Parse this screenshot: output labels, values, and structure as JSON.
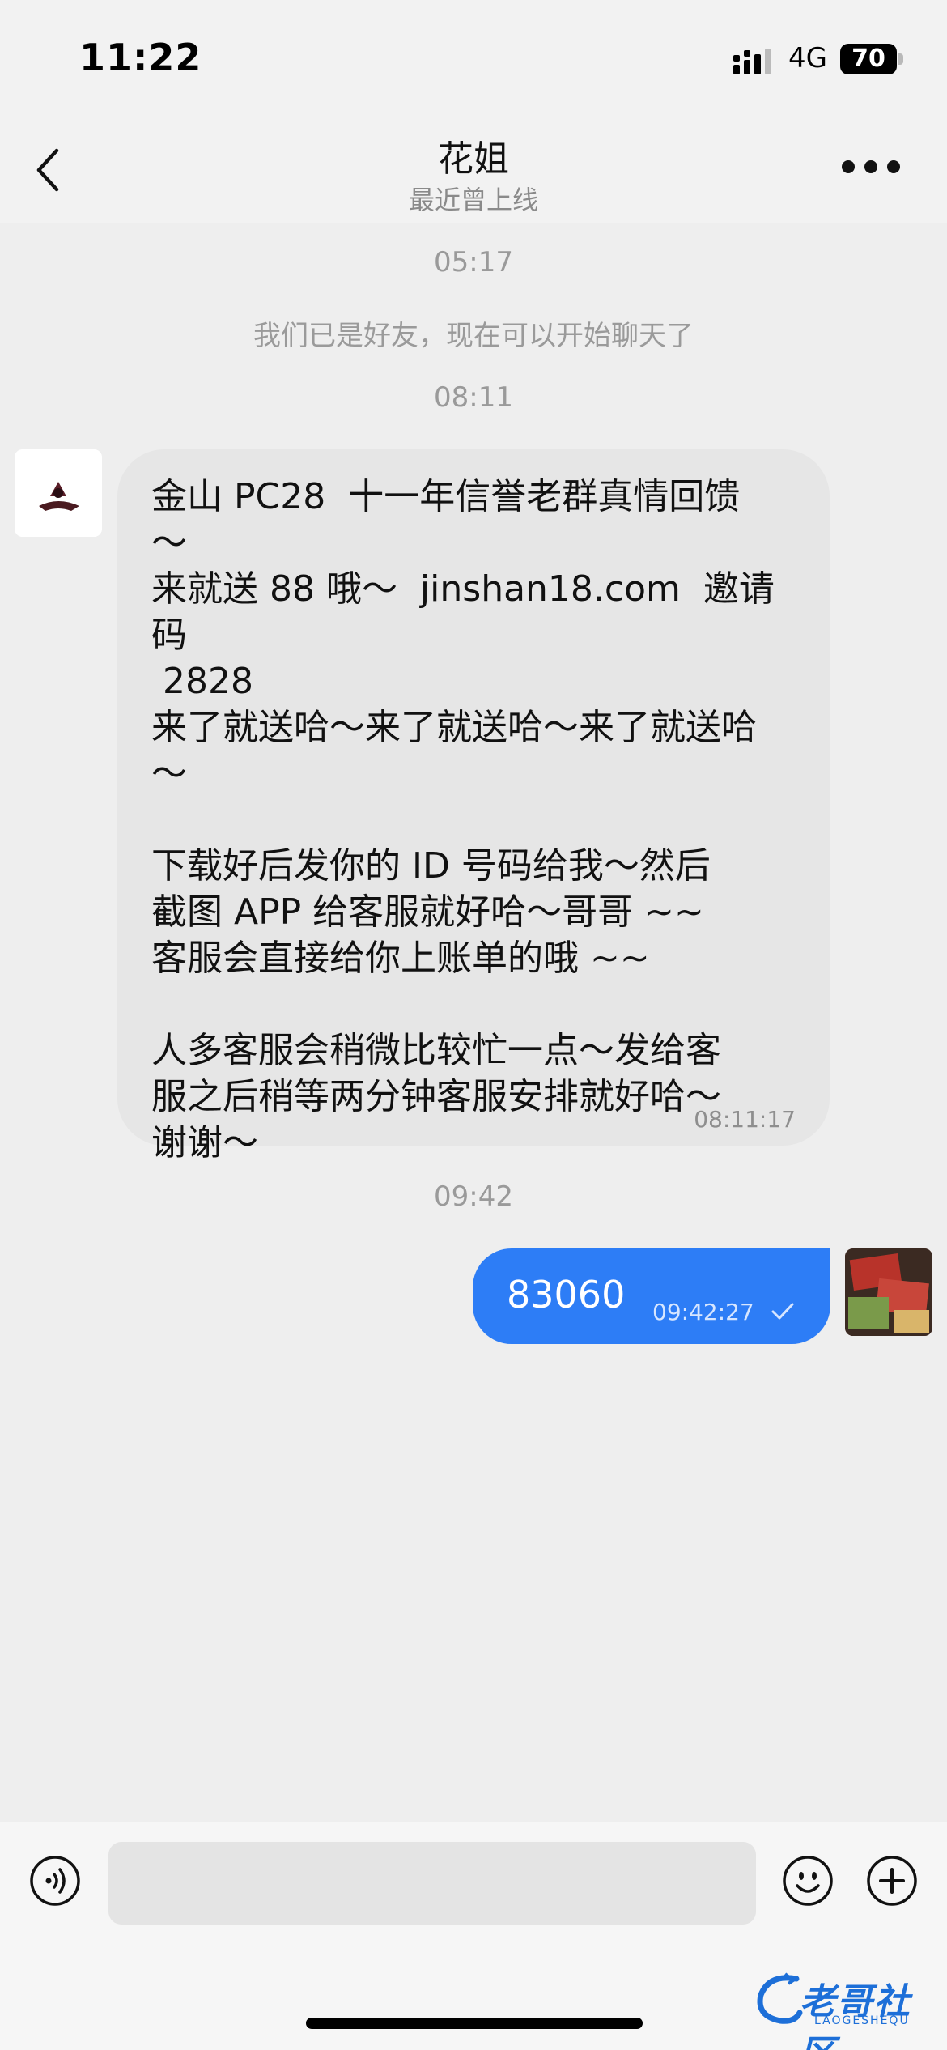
{
  "status_bar": {
    "time": "11:22",
    "network": "4G",
    "battery": "70"
  },
  "header": {
    "name": "花姐",
    "status": "最近曾上线"
  },
  "chat": {
    "separators": [
      "05:17",
      "08:11",
      "09:42"
    ],
    "system_message": "我们已是好友，现在可以开始聊天了",
    "incoming": {
      "lines": [
        "金山 PC28  十一年信誉老群真情回馈",
        "～",
        "来就送 88 哦～  jinshan18.com  邀请码",
        " 2828",
        "来了就送哈～来了就送哈～来了就送哈",
        "～",
        "",
        "下载好后发你的 ID 号码给我～然后",
        "截图 APP 给客服就好哈～哥哥 ~~",
        "客服会直接给你上账单的哦 ~~",
        "",
        "人多客服会稍微比较忙一点～发给客",
        "服之后稍等两分钟客服安排就好哈～",
        "谢谢～"
      ],
      "time": "08:11:17"
    },
    "outgoing": {
      "text": "83060",
      "time": "09:42:27"
    }
  },
  "input": {
    "placeholder": ""
  },
  "watermark": {
    "text": "老哥社区",
    "sub": "LAOGESHEQU"
  },
  "colors": {
    "accent": "#2d7df6",
    "background": "#eeeeee",
    "bubble_in": "#e6e6e6"
  }
}
